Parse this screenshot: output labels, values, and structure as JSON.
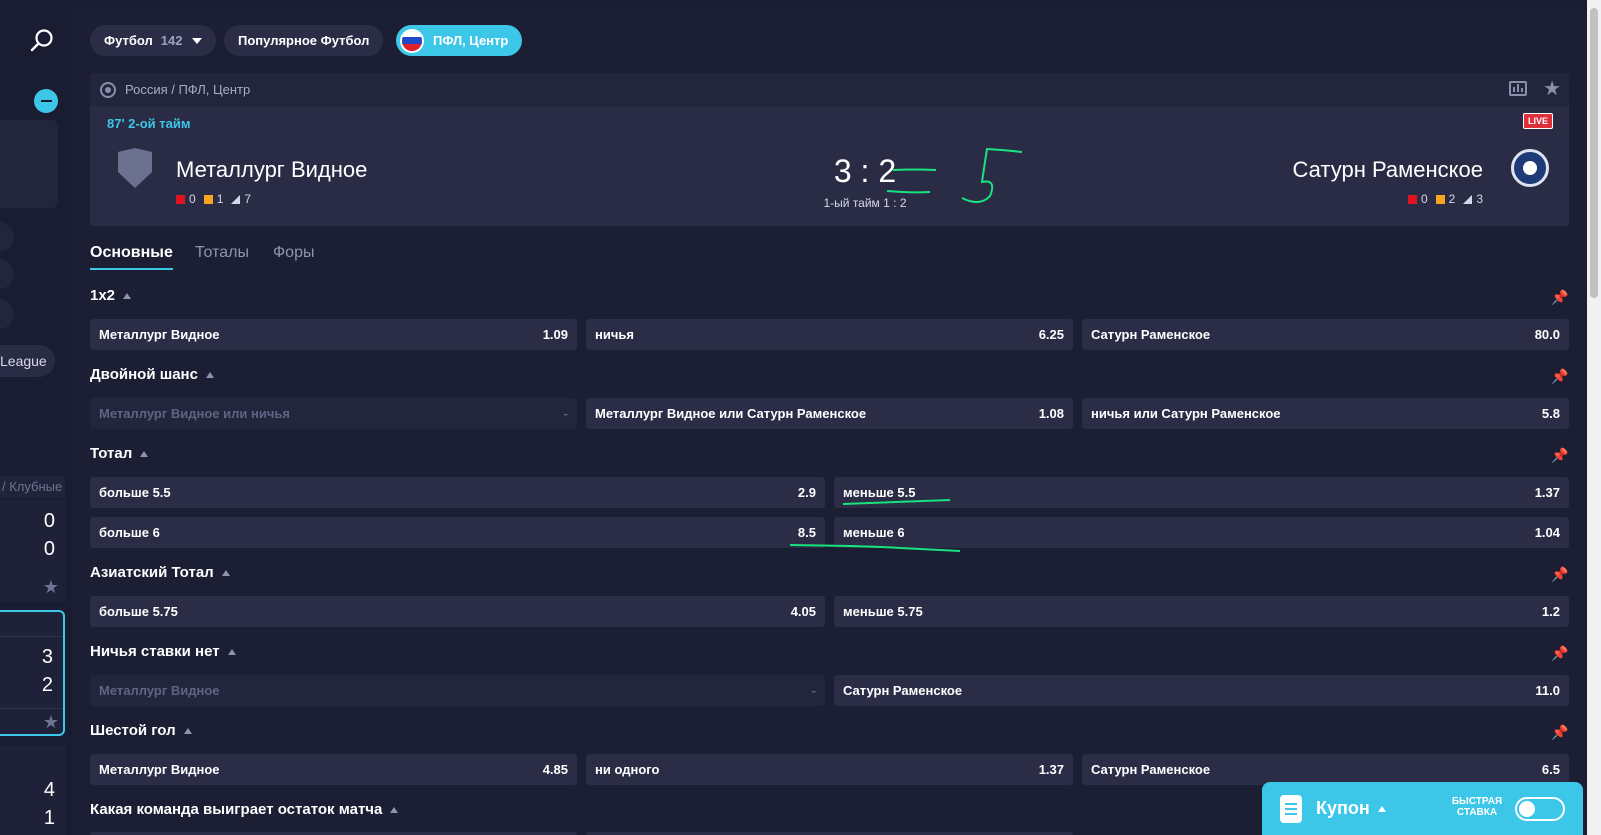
{
  "header": {
    "sport_pill": {
      "label": "Футбол",
      "count": "142"
    },
    "popular_pill": "Популярное Футбол",
    "league_pill": "ПФЛ, Центр"
  },
  "sidebar": {
    "league_fragment": "League",
    "category_fragment": "/ Клубные",
    "score_cards": [
      {
        "home": "0",
        "away": "0"
      },
      {
        "home": "3",
        "away": "2"
      },
      {
        "home": "4",
        "away": "1"
      }
    ]
  },
  "match": {
    "breadcrumb": "Россия / ПФЛ, Центр",
    "live_time": "87' 2-ой тайм",
    "live_badge": "LIVE",
    "home": {
      "name": "Металлург Видное",
      "red": "0",
      "yellow": "1",
      "corners": "7"
    },
    "away": {
      "name": "Сатурн Раменское",
      "red": "0",
      "yellow": "2",
      "corners": "3"
    },
    "score": "3 : 2",
    "first_half": "1-ый тайм  1 : 2"
  },
  "tabs": [
    "Основные",
    "Тоталы",
    "Форы"
  ],
  "markets": {
    "m1x2": {
      "title": "1x2",
      "outcomes": [
        {
          "label": "Металлург Видное",
          "odd": "1.09"
        },
        {
          "label": "ничья",
          "odd": "6.25"
        },
        {
          "label": "Сатурн Раменское",
          "odd": "80.0"
        }
      ]
    },
    "double": {
      "title": "Двойной шанс",
      "outcomes": [
        {
          "label": "Металлург Видное или ничья",
          "odd": "-"
        },
        {
          "label": "Металлург Видное или Сатурн Раменское",
          "odd": "1.08"
        },
        {
          "label": "ничья или Сатурн Раменское",
          "odd": "5.8"
        }
      ]
    },
    "total": {
      "title": "Тотал",
      "outcomes": [
        {
          "label": "больше 5.5",
          "odd": "2.9"
        },
        {
          "label": "меньше 5.5",
          "odd": "1.37"
        },
        {
          "label": "больше 6",
          "odd": "8.5"
        },
        {
          "label": "меньше 6",
          "odd": "1.04"
        }
      ]
    },
    "asian": {
      "title": "Азиатский Тотал",
      "outcomes": [
        {
          "label": "больше 5.75",
          "odd": "4.05"
        },
        {
          "label": "меньше 5.75",
          "odd": "1.2"
        }
      ]
    },
    "dnb": {
      "title": "Ничья ставки нет",
      "outcomes": [
        {
          "label": "Металлург Видное",
          "odd": "-"
        },
        {
          "label": "Сатурн Раменское",
          "odd": "11.0"
        }
      ]
    },
    "sixth": {
      "title": "Шестой гол",
      "outcomes": [
        {
          "label": "Металлург Видное",
          "odd": "4.85"
        },
        {
          "label": "ни одного",
          "odd": "1.37"
        },
        {
          "label": "Сатурн Раменское",
          "odd": "6.5"
        }
      ]
    },
    "rest": {
      "title": "Какая команда выиграет остаток матча"
    }
  },
  "coupon": {
    "label": "Купон",
    "quick_line1": "БЫСТРАЯ",
    "quick_line2": "СТАВКА"
  },
  "colors": {
    "accent": "#3cc7e9",
    "bg": "#1c1e34",
    "odd_bg": "#2b2d47",
    "annotation": "#19e37d",
    "red_card": "#e0141e",
    "yellow_card": "#f5a623"
  }
}
